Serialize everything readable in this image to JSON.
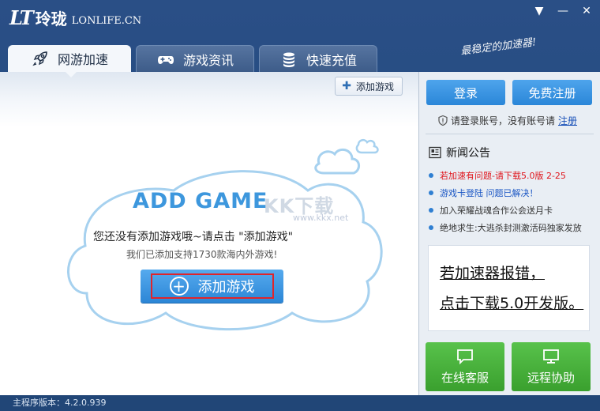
{
  "app": {
    "logo_mark": "LT",
    "logo_name": "玲珑",
    "logo_site": "LONLIFE.CN",
    "slogan": "最稳定的加速器!"
  },
  "window_controls": [
    {
      "name": "menu",
      "glyph": "▼"
    },
    {
      "name": "minimize",
      "glyph": "—"
    },
    {
      "name": "close",
      "glyph": "✕"
    }
  ],
  "tabs": [
    {
      "label": "网游加速",
      "icon": "rocket-icon",
      "active": true
    },
    {
      "label": "游戏资讯",
      "icon": "gamepad-icon",
      "active": false
    },
    {
      "label": "快速充值",
      "icon": "coins-icon",
      "active": false
    }
  ],
  "main": {
    "add_game_top_label": "添加游戏",
    "title": "ADD GAME",
    "watermark": "KK下载",
    "watermark_url": "www.kkx.net",
    "empty_message": "您还没有添加游戏哦~请点击 \"添加游戏\"",
    "support_message": "我们已添加支持1730款海内外游戏!",
    "add_button_label": "添加游戏"
  },
  "side": {
    "login_label": "登录",
    "register_label": "免费注册",
    "login_hint": "请登录账号，没有账号请",
    "register_link": "注册",
    "news_title": "新闻公告",
    "news": [
      {
        "text": "若加速有问题-请下载5.0版 2-25",
        "color": "#e0141b"
      },
      {
        "text": "游戏卡登陆 问题已解决！",
        "color": "#1a56c4"
      },
      {
        "text": "加入荣耀战魂合作公会送月卡",
        "color": "#333333"
      },
      {
        "text": "绝地求生:大逃杀封测激活码独家发放",
        "color": "#333333"
      }
    ],
    "ad_line1": "若加速器报错，",
    "ad_line2": "点击下载5.0开发版。",
    "service_label": "在线客服",
    "remote_label": "远程协助"
  },
  "status": {
    "version_label": "主程序版本：",
    "version": "4.2.0.939"
  },
  "colors": {
    "header_blue": "#2a4f86",
    "accent_blue": "#2c86d6",
    "green": "#3aa02e",
    "highlight_red": "#e0242a"
  }
}
